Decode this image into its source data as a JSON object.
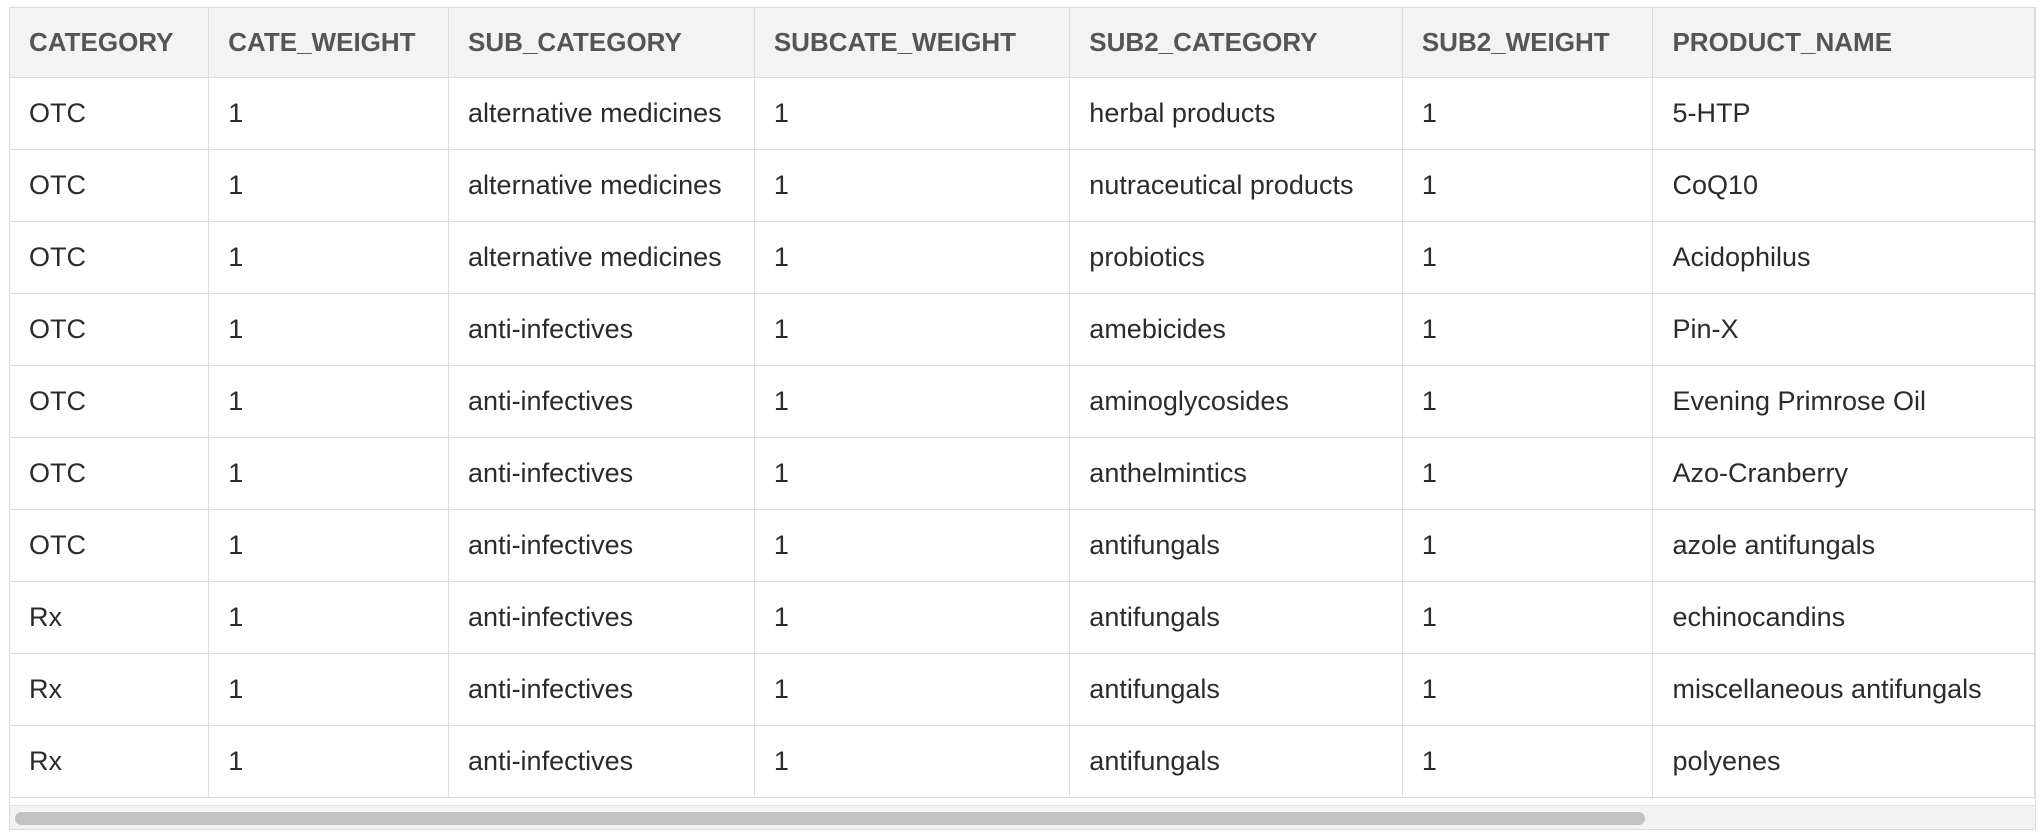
{
  "table": {
    "columns": [
      "CATEGORY",
      "CATE_WEIGHT",
      "SUB_CATEGORY",
      "SUBCATE_WEIGHT",
      "SUB2_CATEGORY",
      "SUB2_WEIGHT",
      "PRODUCT_NAME"
    ],
    "rows": [
      [
        "OTC",
        "1",
        "alternative medicines",
        "1",
        "herbal products",
        "1",
        "5-HTP"
      ],
      [
        "OTC",
        "1",
        "alternative medicines",
        "1",
        "nutraceutical products",
        "1",
        "CoQ10"
      ],
      [
        "OTC",
        "1",
        "alternative medicines",
        "1",
        "probiotics",
        "1",
        "Acidophilus"
      ],
      [
        "OTC",
        "1",
        "anti-infectives",
        "1",
        "amebicides",
        "1",
        "Pin-X"
      ],
      [
        "OTC",
        "1",
        "anti-infectives",
        "1",
        "aminoglycosides",
        "1",
        "Evening Primrose Oil"
      ],
      [
        "OTC",
        "1",
        "anti-infectives",
        "1",
        "anthelmintics",
        "1",
        "Azo-Cranberry"
      ],
      [
        "OTC",
        "1",
        "anti-infectives",
        "1",
        "antifungals",
        "1",
        "azole antifungals"
      ],
      [
        "Rx",
        "1",
        "anti-infectives",
        "1",
        "antifungals",
        "1",
        "echinocandins"
      ],
      [
        "Rx",
        "1",
        "anti-infectives",
        "1",
        "antifungals",
        "1",
        "miscellaneous antifungals"
      ],
      [
        "Rx",
        "1",
        "anti-infectives",
        "1",
        "antifungals",
        "1",
        "polyenes"
      ]
    ]
  },
  "colors": {
    "header_background": "#f3f3f3",
    "border": "#dcdcdc",
    "scrollbar_thumb": "#c2c2c2"
  }
}
